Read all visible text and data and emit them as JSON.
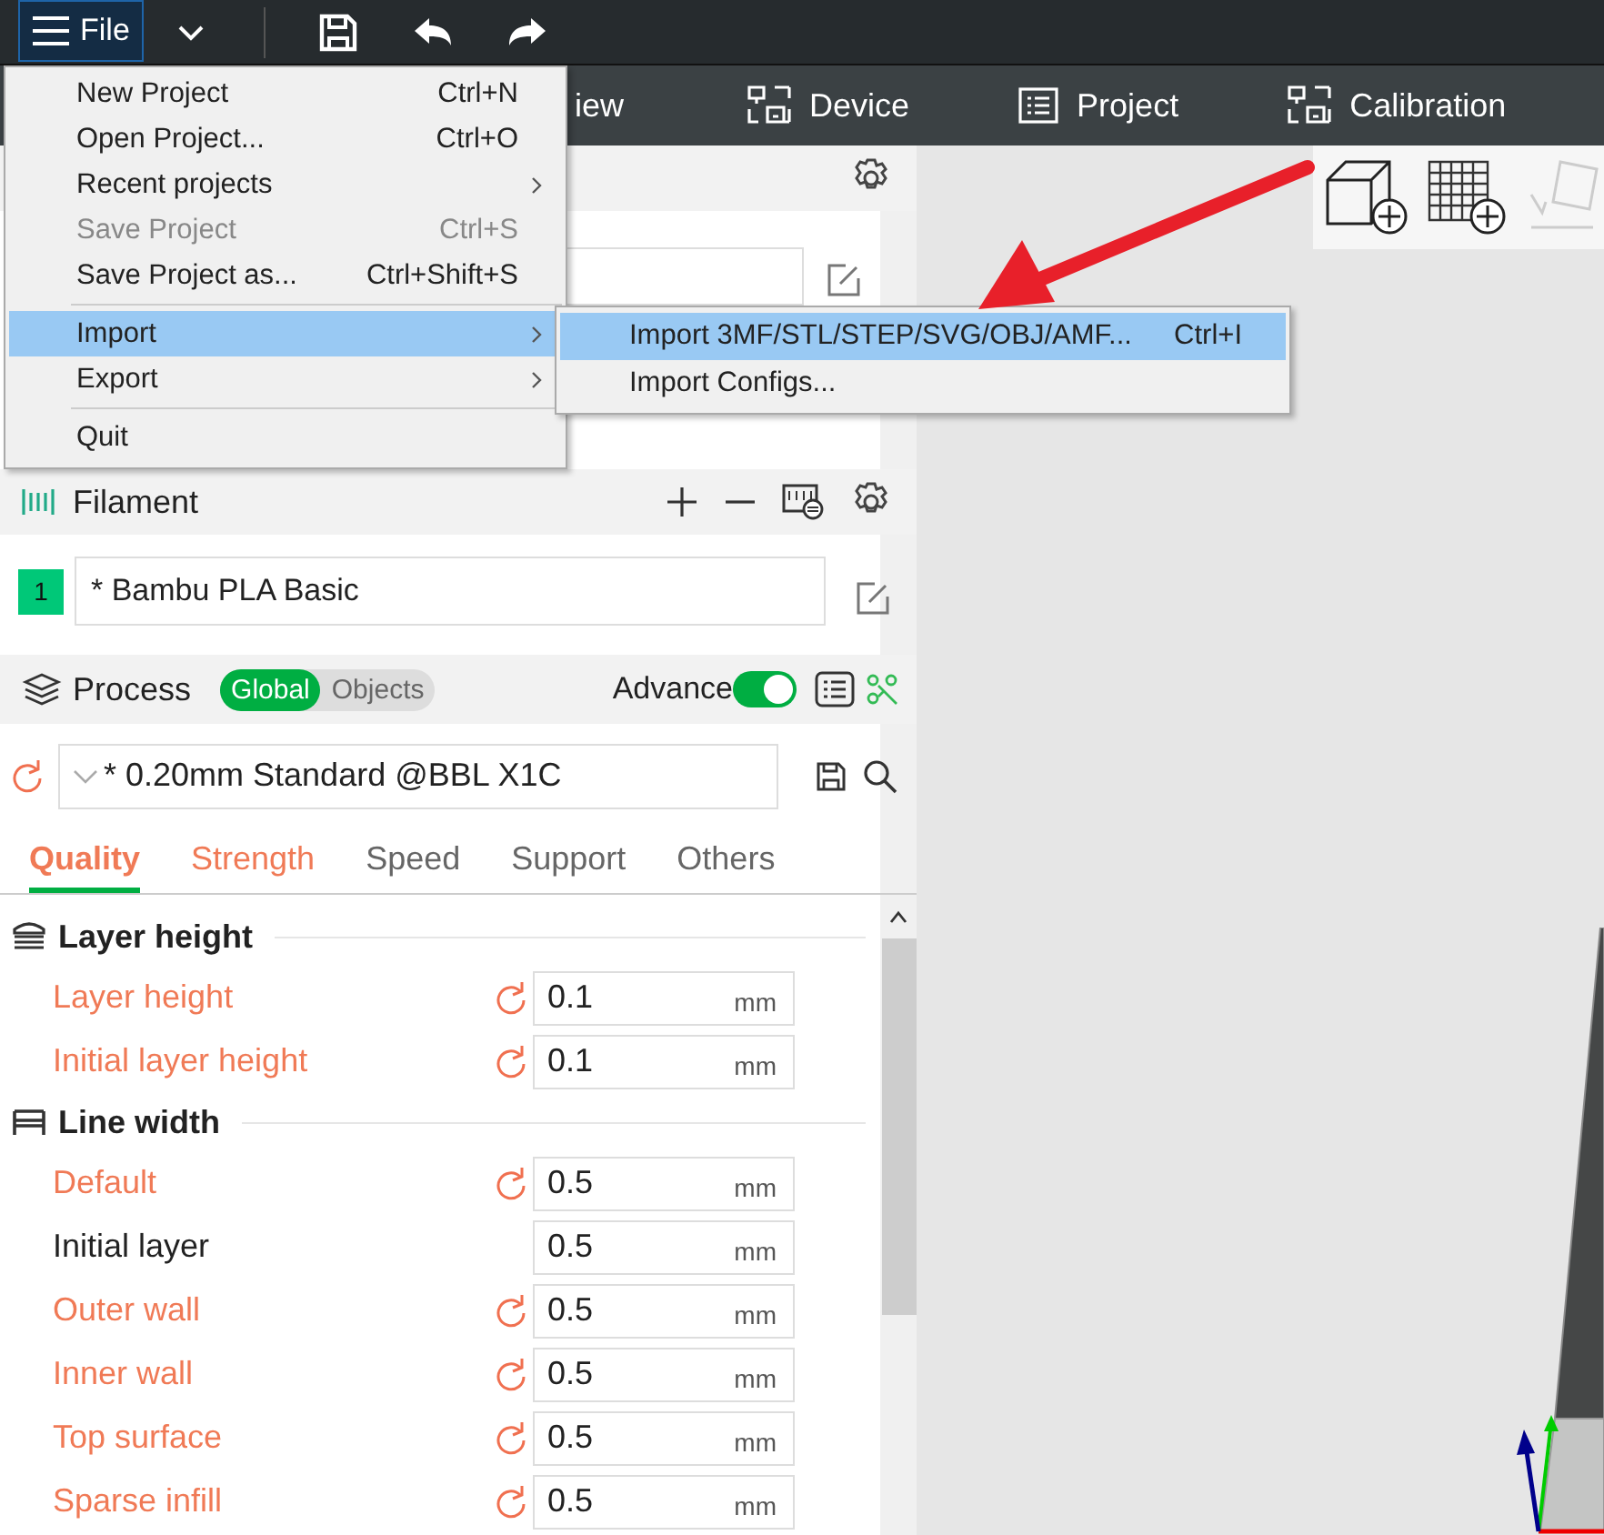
{
  "toolbar": {
    "file_button": "File"
  },
  "top_tabs": [
    {
      "label": "iew",
      "kind": "plain"
    },
    {
      "label": "Device",
      "kind": "device"
    },
    {
      "label": "Project",
      "kind": "list"
    },
    {
      "label": "Calibration",
      "kind": "device"
    }
  ],
  "file_menu": [
    {
      "label": "New Project",
      "shortcut": "Ctrl+N",
      "disabled": false,
      "submenu": false,
      "selected": false,
      "separator_before": false
    },
    {
      "label": "Open Project...",
      "shortcut": "Ctrl+O",
      "disabled": false,
      "submenu": false,
      "selected": false,
      "separator_before": false
    },
    {
      "label": "Recent projects",
      "disabled": false,
      "submenu": true,
      "selected": false,
      "separator_before": false
    },
    {
      "label": "Save Project",
      "shortcut": "Ctrl+S",
      "disabled": true,
      "submenu": false,
      "selected": false,
      "separator_before": false
    },
    {
      "label": "Save Project as...",
      "shortcut": "Ctrl+Shift+S",
      "disabled": false,
      "submenu": false,
      "selected": false,
      "separator_before": false
    },
    {
      "label": "Import",
      "disabled": false,
      "submenu": true,
      "selected": true,
      "separator_before": true
    },
    {
      "label": "Export",
      "disabled": false,
      "submenu": true,
      "selected": false,
      "separator_before": false
    },
    {
      "label": "Quit",
      "disabled": false,
      "submenu": false,
      "selected": false,
      "separator_before": true
    }
  ],
  "import_submenu": [
    {
      "label": "Import 3MF/STL/STEP/SVG/OBJ/AMF...",
      "shortcut": "Ctrl+I",
      "selected": true
    },
    {
      "label": "Import Configs...",
      "selected": false
    }
  ],
  "filament": {
    "title": "Filament",
    "slots": [
      {
        "number": "1",
        "color": "#00c878",
        "name": "* Bambu PLA Basic"
      }
    ]
  },
  "process": {
    "title": "Process",
    "scopes": [
      {
        "label": "Global",
        "selected": true
      },
      {
        "label": "Objects",
        "selected": false
      }
    ],
    "advance_label": "Advance",
    "advance_on": true,
    "preset": "* 0.20mm Standard @BBL X1C"
  },
  "setting_tabs": [
    {
      "label": "Quality",
      "selected": true,
      "modified": true
    },
    {
      "label": "Strength",
      "selected": false,
      "modified": true
    },
    {
      "label": "Speed",
      "selected": false,
      "modified": false
    },
    {
      "label": "Support",
      "selected": false,
      "modified": false
    },
    {
      "label": "Others",
      "selected": false,
      "modified": false
    }
  ],
  "groups": [
    {
      "title": "Layer height",
      "kind": "layers",
      "settings": [
        {
          "label": "Layer height",
          "value": "0.1",
          "unit": "mm",
          "modified": true
        },
        {
          "label": "Initial layer height",
          "value": "0.1",
          "unit": "mm",
          "modified": true
        }
      ]
    },
    {
      "title": "Line width",
      "kind": "line",
      "settings": [
        {
          "label": "Default",
          "value": "0.5",
          "unit": "mm",
          "modified": true
        },
        {
          "label": "Initial layer",
          "value": "0.5",
          "unit": "mm",
          "modified": false
        },
        {
          "label": "Outer wall",
          "value": "0.5",
          "unit": "mm",
          "modified": true
        },
        {
          "label": "Inner wall",
          "value": "0.5",
          "unit": "mm",
          "modified": true
        },
        {
          "label": "Top surface",
          "value": "0.5",
          "unit": "mm",
          "modified": true
        },
        {
          "label": "Sparse infill",
          "value": "0.5",
          "unit": "mm",
          "modified": true
        }
      ]
    }
  ]
}
